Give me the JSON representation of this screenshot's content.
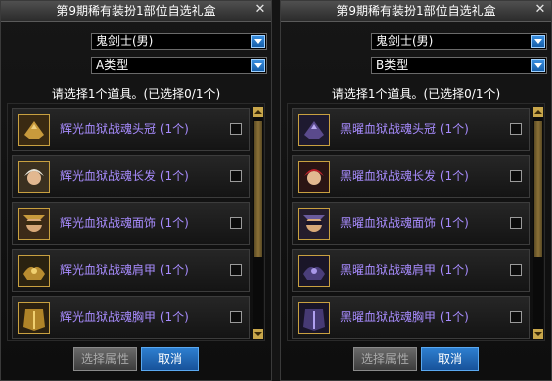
{
  "panels": [
    {
      "title": "第9期稀有装扮1部位自选礼盒",
      "job_select": "鬼剑士(男)",
      "type_select": "A类型",
      "instruction": "请选择1个道具。(已选择0/1个)",
      "items": [
        {
          "name": "辉光血狱战魂头冠 (1个)",
          "icon": "helmet-icon"
        },
        {
          "name": "辉光血狱战魂长发 (1个)",
          "icon": "hair-icon"
        },
        {
          "name": "辉光血狱战魂面饰 (1个)",
          "icon": "face-accessory-icon"
        },
        {
          "name": "辉光血狱战魂肩甲 (1个)",
          "icon": "shoulder-armor-icon"
        },
        {
          "name": "辉光血狱战魂胸甲 (1个)",
          "icon": "chest-armor-icon"
        }
      ],
      "buttons": {
        "select_attr": "选择属性",
        "cancel": "取消"
      }
    },
    {
      "title": "第9期稀有装扮1部位自选礼盒",
      "job_select": "鬼剑士(男)",
      "type_select": "B类型",
      "instruction": "请选择1个道具。(已选择0/1个)",
      "items": [
        {
          "name": "黑曜血狱战魂头冠 (1个)",
          "icon": "helmet-icon"
        },
        {
          "name": "黑曜血狱战魂长发 (1个)",
          "icon": "hair-icon"
        },
        {
          "name": "黑曜血狱战魂面饰 (1个)",
          "icon": "face-accessory-icon"
        },
        {
          "name": "黑曜血狱战魂肩甲 (1个)",
          "icon": "shoulder-armor-icon"
        },
        {
          "name": "黑曜血狱战魂胸甲 (1个)",
          "icon": "chest-armor-icon"
        }
      ],
      "buttons": {
        "select_attr": "选择属性",
        "cancel": "取消"
      }
    }
  ],
  "colors": {
    "item_text": "#a88cff",
    "cancel_button": "#2e7fd0",
    "icon_border": "#c8a040",
    "scrollbar": "#c8a64a"
  }
}
